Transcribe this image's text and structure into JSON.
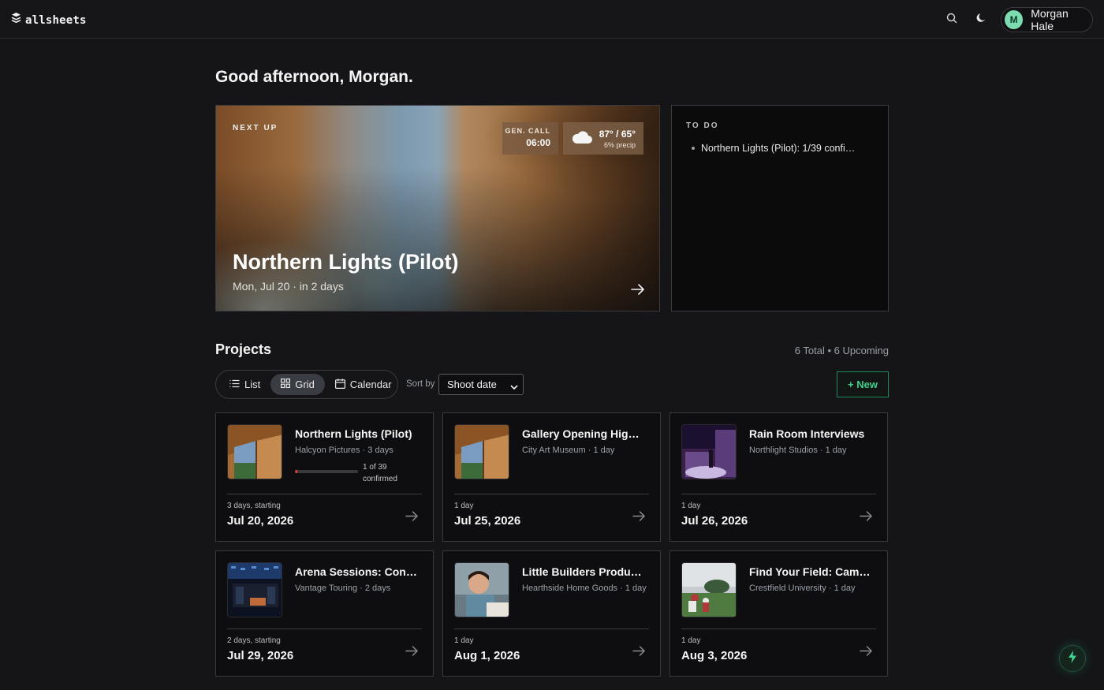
{
  "app": {
    "name": "allsheets"
  },
  "user": {
    "initial": "M",
    "name": "Morgan Hale"
  },
  "greeting": "Good afternoon, Morgan.",
  "hero": {
    "label": "NEXT UP",
    "title": "Northern Lights (Pilot)",
    "subtitle": "Mon, Jul 20 · in 2 days",
    "gen_call_label": "GEN. CALL",
    "gen_call_time": "06:00",
    "weather_temp": "87° / 65°",
    "weather_precip": "6% precip",
    "weather_icon": "cloud-icon"
  },
  "todo": {
    "label": "TO DO",
    "items": [
      {
        "text": "Northern Lights (Pilot): 1/39 confi…"
      }
    ]
  },
  "projects": {
    "title": "Projects",
    "count": "6 Total • 6 Upcoming",
    "views": [
      "List",
      "Grid",
      "Calendar"
    ],
    "active_view": "Grid",
    "sort_label": "Sort by",
    "sort_value": "Shoot date",
    "new_label": "+ New"
  },
  "cards": [
    {
      "title": "Northern Lights (Pilot)",
      "meta": "Halcyon Pictures · 3 days",
      "progress_text_1": "1 of 39",
      "progress_text_2": "confirmed",
      "progress": 0.026,
      "duration": "3 days, starting",
      "date": "Jul 20, 2026"
    },
    {
      "title": "Gallery Opening Hig…",
      "meta": "City Art Museum · 1 day",
      "duration": "1 day",
      "date": "Jul 25, 2026"
    },
    {
      "title": "Rain Room Interviews",
      "meta": "Northlight Studios · 1 day",
      "duration": "1 day",
      "date": "Jul 26, 2026"
    },
    {
      "title": "Arena Sessions: Con…",
      "meta": "Vantage Touring · 2 days",
      "duration": "2 days, starting",
      "date": "Jul 29, 2026"
    },
    {
      "title": "Little Builders Produ…",
      "meta": "Hearthside Home Goods · 1 day",
      "duration": "1 day",
      "date": "Aug 1, 2026"
    },
    {
      "title": "Find Your Field: Cam…",
      "meta": "Crestfield University · 1 day",
      "duration": "1 day",
      "date": "Aug 3, 2026"
    }
  ],
  "colors": {
    "accent": "#3fcf8e",
    "background": "#151517",
    "card": "#0e0e10",
    "progress": "#e03a3a"
  }
}
